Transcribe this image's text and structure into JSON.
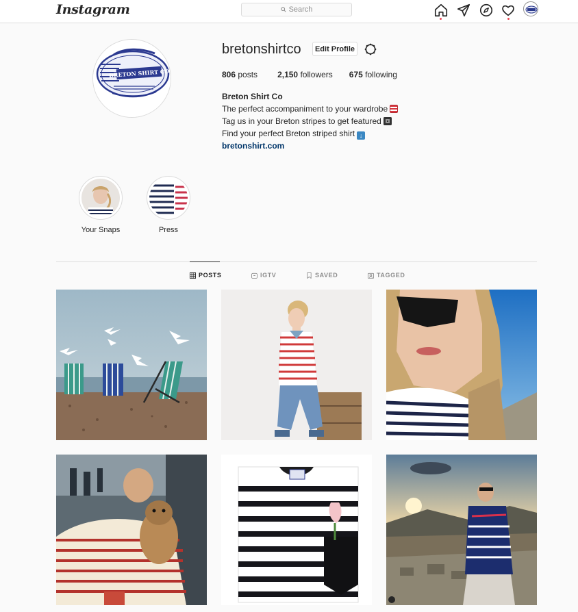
{
  "topnav": {
    "logo": "Instagram",
    "search_placeholder": "Search",
    "icons": [
      "home-icon",
      "direct-icon",
      "explore-icon",
      "activity-heart-icon",
      "profile-avatar-icon"
    ]
  },
  "profile": {
    "username": "bretonshirtco",
    "edit_label": "Edit Profile",
    "stats": [
      {
        "num": "806",
        "label": "posts"
      },
      {
        "num": "2,150",
        "label": "followers"
      },
      {
        "num": "675",
        "label": "following"
      }
    ],
    "bio": {
      "name": "Breton Shirt Co",
      "lines": [
        "The perfect accompaniment to your wardrobe",
        "Tag us in your Breton stripes to get featured",
        "Find your perfect Breton striped shirt"
      ],
      "link": "bretonshirt.com"
    },
    "logo_text": "BRETON SHIRT CO"
  },
  "highlights": [
    {
      "label": "Your Snaps"
    },
    {
      "label": "Press"
    }
  ],
  "tabs": [
    {
      "label": "POSTS",
      "icon": "grid-icon",
      "active": true
    },
    {
      "label": "IGTV",
      "icon": "igtv-icon",
      "active": false
    },
    {
      "label": "SAVED",
      "icon": "bookmark-icon",
      "active": false
    },
    {
      "label": "TAGGED",
      "icon": "tag-icon",
      "active": false
    }
  ],
  "posts": [
    {
      "subject": "deck chairs and seagulls on beach"
    },
    {
      "subject": "woman in red striped top sitting on crate"
    },
    {
      "subject": "woman in sunglasses selfie"
    },
    {
      "subject": "man with dog in cafe"
    },
    {
      "subject": "folded striped shirt with tulip"
    },
    {
      "subject": "man on mountain at sunset"
    }
  ],
  "colors": {
    "accent": "#ed4956",
    "link": "#003569",
    "border": "#dbdbdb"
  }
}
